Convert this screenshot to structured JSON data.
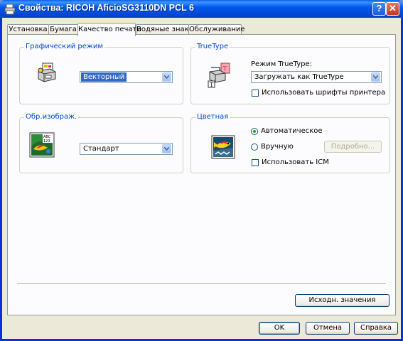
{
  "window": {
    "title": "Свойства: RICOH AficioSG3110DN PCL 6"
  },
  "titlebar": {
    "help_label": "?",
    "close_label": "✕"
  },
  "tabs": [
    {
      "label": "Установка"
    },
    {
      "label": "Бумага"
    },
    {
      "label": "Качество печати",
      "active": true
    },
    {
      "label": "Водяные знаки"
    },
    {
      "label": "Обслуживание"
    }
  ],
  "graphics_mode": {
    "group_label": "Графический режим",
    "icon": "printer-graphics-icon",
    "select_value": "Векторный"
  },
  "truetype": {
    "group_label": "TrueType",
    "icon": "printer-truetype-icon",
    "mode_label": "Режим TrueType:",
    "select_value": "Загружать как TrueType",
    "use_printer_fonts_label": "Использовать шрифты принтера",
    "use_printer_fonts_checked": false
  },
  "image_processing": {
    "group_label": "Обр.изображ.",
    "icon": "image-abc-icon",
    "icon_text": "ABC 123",
    "select_value": "Стандарт"
  },
  "color": {
    "group_label": "Цветная",
    "icon": "color-fish-icon",
    "auto_label": "Автоматическое",
    "manual_label": "Вручную",
    "selected": "Автоматическое",
    "details_label": "Подробно...",
    "use_icm_label": "Использовать ICM",
    "use_icm_checked": false
  },
  "defaults_button": "Исходн. значения",
  "footer": {
    "ok": "OK",
    "cancel": "Отмена",
    "help": "Справка"
  },
  "colors": {
    "titlebar": "#0054e3",
    "dialog_bg": "#ece9d8",
    "group_label": "#0046d5",
    "selection": "#316ac5"
  }
}
